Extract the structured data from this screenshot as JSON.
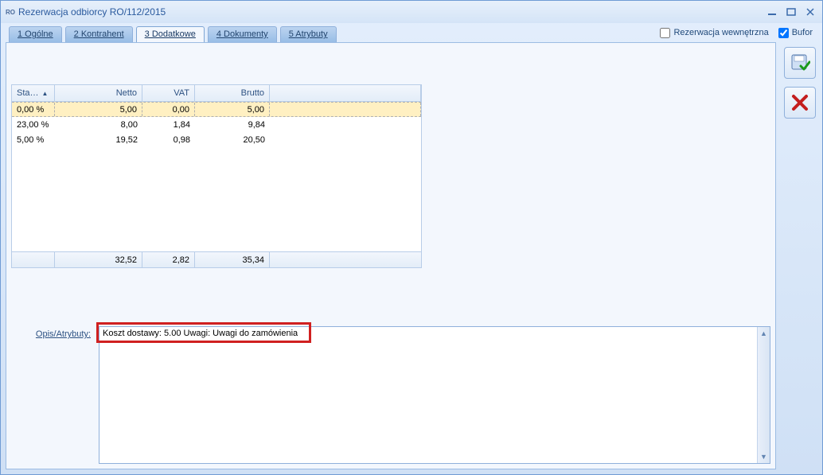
{
  "window": {
    "title": "Rezerwacja odbiorcy RO/112/2015"
  },
  "tabs": [
    {
      "prefix": "1",
      "label": "Ogólne"
    },
    {
      "prefix": "2",
      "label": "Kontrahent"
    },
    {
      "prefix": "3",
      "label": "Dodatkowe",
      "active": true
    },
    {
      "prefix": "4",
      "label": "Dokumenty"
    },
    {
      "prefix": "5",
      "label": "Atrybuty"
    }
  ],
  "checkboxes": {
    "rezerwacja_wewnetrzna": {
      "label": "Rezerwacja wewnętrzna",
      "checked": false
    },
    "bufor": {
      "label": "Bufor",
      "checked": true
    }
  },
  "grid": {
    "headers": {
      "sta": "Sta…",
      "netto": "Netto",
      "vat": "VAT",
      "brutto": "Brutto"
    },
    "rows": [
      {
        "sta": "0,00  %",
        "netto": "5,00",
        "vat": "0,00",
        "brutto": "5,00",
        "selected": true
      },
      {
        "sta": "23,00  %",
        "netto": "8,00",
        "vat": "1,84",
        "brutto": "9,84"
      },
      {
        "sta": "5,00  %",
        "netto": "19,52",
        "vat": "0,98",
        "brutto": "20,50"
      }
    ],
    "footer": {
      "netto": "32,52",
      "vat": "2,82",
      "brutto": "35,34"
    }
  },
  "description": {
    "label": "Opis/Atrybuty:",
    "text": "Koszt dostawy: 5.00 Uwagi: Uwagi do zamówienia"
  },
  "icons": {
    "save": "save-check-icon",
    "cancel": "red-x-icon"
  }
}
